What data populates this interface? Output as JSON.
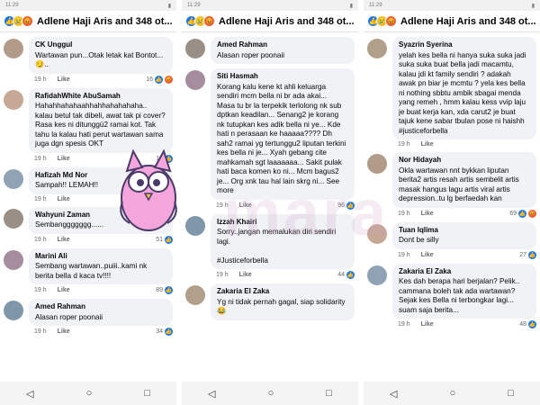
{
  "status_time": "11:29",
  "header_title": "Adlene Haji Aris and 348 ot...",
  "panels": [
    {
      "comments": [
        {
          "name": "CK Unggul",
          "text": "Wartawan pun...Otak letak kat Bontot...😏..",
          "time": "19 h",
          "like": "Like",
          "count": "16",
          "reacts": [
            "like",
            "angry"
          ]
        },
        {
          "name": "RafidahWhite AbuSamah",
          "text": "Hahahhahahaahhahhahahahaha..\nkalau betul tak dibeli, awat tak pi cover? Rasa kes ni ditunggü2 ramai kot. Tak tahu la kalau hati perut wartawan sama juga dgn spesis OKT",
          "time": "19 h",
          "like": "Like",
          "count": "15",
          "reacts": [
            "like"
          ]
        },
        {
          "name": "Hafizah Md Nor",
          "text": "Sampah!! LEMAH!!",
          "time": "19 h",
          "like": "Like",
          "count": "",
          "reacts": []
        },
        {
          "name": "Wahyuni Zaman",
          "text": "Sembanggggggg......",
          "time": "19 h",
          "like": "Like",
          "count": "51",
          "reacts": [
            "like"
          ]
        },
        {
          "name": "Marini Ali",
          "text": "Sembang wartawan..puiii..kami nk berita bella d kaca tv!!!!",
          "time": "19 h",
          "like": "Like",
          "count": "89",
          "reacts": [
            "like"
          ]
        },
        {
          "name": "Amed Rahman",
          "text": "Alasan roper poonaii",
          "time": "19 h",
          "like": "Like",
          "count": "34",
          "reacts": [
            "like"
          ]
        }
      ]
    },
    {
      "comments": [
        {
          "name": "Amed Rahman",
          "text": "Alasan roper poonaii",
          "time": "",
          "like": "",
          "count": "",
          "reacts": []
        },
        {
          "name": "Siti Hasmah",
          "text": "Korang kalu kene kt ahli keluarga sendiri mcm bella ni br ada akai...\nMasa tu br la terpekik terlolong nk sub dptkan keadilan... Senang2 je korang nk tutupkan kes adik bella ni ye... Kde hati n perasaan ke haaaaa???? Dh sah2 ramai yg tertunggu2 liputan terkini kes bella ni je... Xyah gebang cite mahkamah sgt laaaaaaa... Sakit pulak hati baca komen ko ni... Mcm bagus2 je... Org xnk tau hal lain skrg ni... See more",
          "time": "19 h",
          "like": "Like",
          "count": "96",
          "reacts": [
            "like"
          ]
        },
        {
          "name": "Izzah Khairi",
          "text": "Sorry..jangan memalukan diri sendiri lagi.\n\n#Justiceforbella",
          "time": "19 h",
          "like": "Like",
          "count": "44",
          "reacts": [
            "like"
          ]
        },
        {
          "name": "Zakaria El Zaka",
          "text": "Yg ni tidak pernah gagal, siap solidarity 😂",
          "time": "",
          "like": "",
          "count": "",
          "reacts": []
        }
      ]
    },
    {
      "comments": [
        {
          "name": "Syazrin Syerina",
          "text": "yelah kes bella ni hanya suka suka jadi suka suka buat bella jadi macamtu, kalau jdi kt family sendiri ? adakah awak pn biar je mcmtu ? yela kes bella ni nothing sbbtu ambik sbagai menda yang remeh , hmm kalau kess vvip laju je buat kerja kan, xda carut2 je buat tajuk kene sabar tbulan pose ni haishh\n#justiceforbella",
          "time": "19 h",
          "like": "Like",
          "count": "",
          "reacts": []
        },
        {
          "name": "Nor Hidayah",
          "text": "Okla wartawan nnt bykkan liputan berita2 artis resah artis sembelit artis masak hangus lagu artis viral artis depression..tu lg berfaedah kan",
          "time": "19 h",
          "like": "Like",
          "count": "69",
          "reacts": [
            "like",
            "angry"
          ]
        },
        {
          "name": "Tuan Iqlima",
          "text": "Dont be silly",
          "time": "19 h",
          "like": "Like",
          "count": "27",
          "reacts": [
            "like"
          ]
        },
        {
          "name": "Zakaria El Zaka",
          "text": "Kes dah berapa hari berjalan? Pelik.. cammana boleh tak ada wartawan? Sejak kes Bella ni terbongkar lagi... suam saja berita...",
          "time": "19 h",
          "like": "Like",
          "count": "48",
          "reacts": [
            "like"
          ]
        }
      ]
    }
  ],
  "watermark": "mara",
  "nav_glyphs": [
    "◁",
    "○",
    "□"
  ]
}
